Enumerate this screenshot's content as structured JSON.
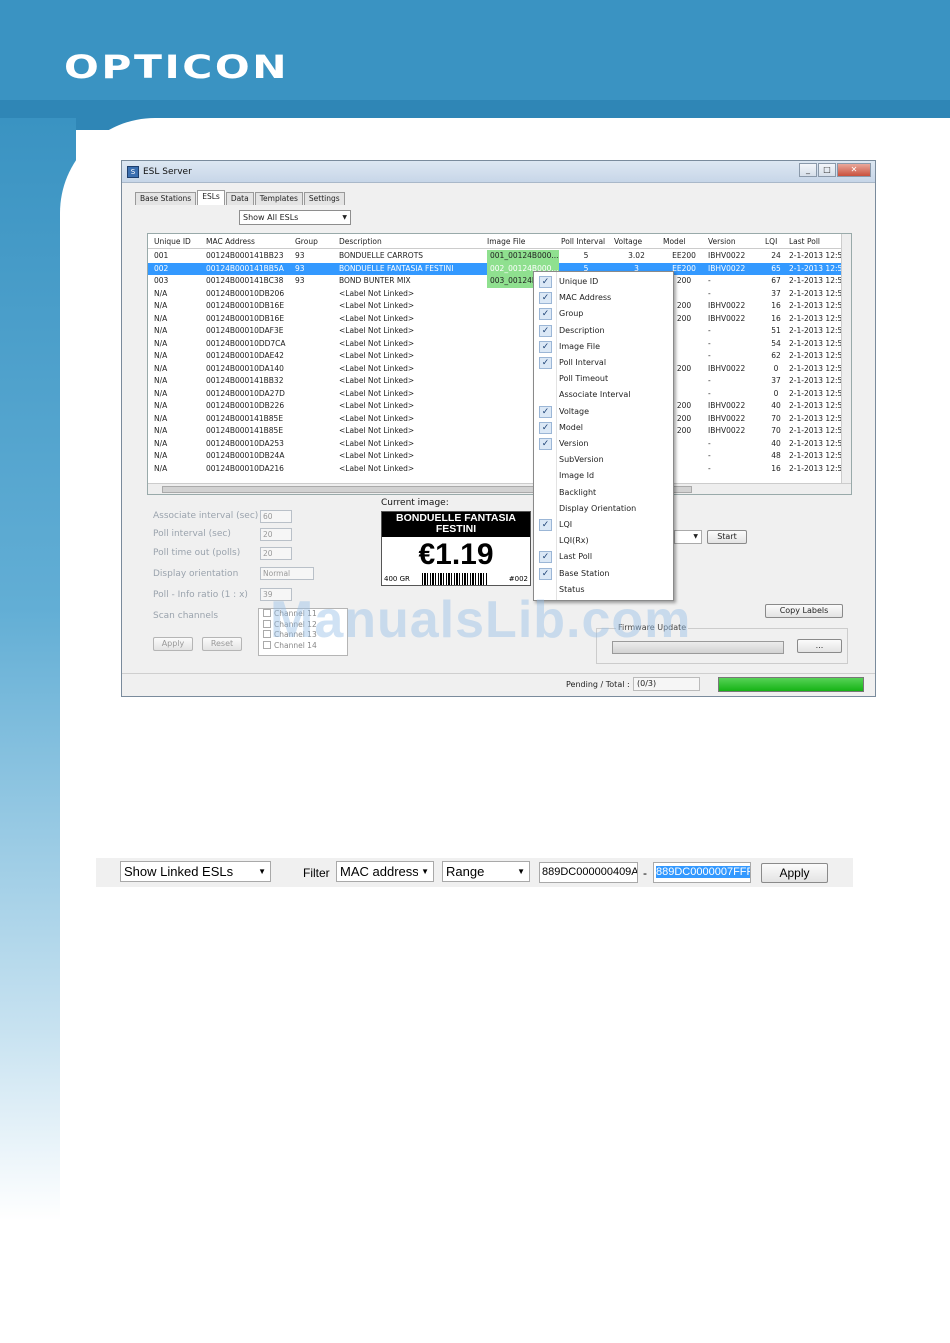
{
  "brand": {
    "logo": "OPTICON"
  },
  "window": {
    "title": "ESL Server",
    "icon_label": "S",
    "tabs": [
      "Base Stations",
      "ESLs",
      "Data",
      "Templates",
      "Settings"
    ],
    "active_tab": "ESLs",
    "view_select": "Show All ESLs",
    "columns": [
      "Unique ID",
      "MAC Address",
      "Group",
      "Description",
      "Image File",
      "Poll Interval",
      "Voltage",
      "Model",
      "Version",
      "LQI",
      "Last Poll"
    ],
    "rows": [
      {
        "id": "001",
        "mac": "00124B000141BB23",
        "group": "93",
        "desc": "BONDUELLE CARROTS",
        "img": "001_00124B000...",
        "poll": "5",
        "volt": "3.02",
        "model": "EE200",
        "ver": "IBHV0022",
        "lqi": "24",
        "last": "2-1-2013 12:5"
      },
      {
        "id": "002",
        "mac": "00124B000141BB5A",
        "group": "93",
        "desc": "BONDUELLE FANTASIA FESTINI",
        "img": "002_00124B000...",
        "poll": "5",
        "volt": "3",
        "model": "EE200",
        "ver": "IBHV0022",
        "lqi": "65",
        "last": "2-1-2013 12:5"
      },
      {
        "id": "003",
        "mac": "00124B000141BC38",
        "group": "93",
        "desc": "BOND BUNTER MIX",
        "img": "003_00124B",
        "poll": "",
        "volt": "",
        "model": "200",
        "ver": "-",
        "lqi": "67",
        "last": "2-1-2013 12:5"
      },
      {
        "id": "N/A",
        "mac": "00124B00010DB206",
        "group": "",
        "desc": "<Label Not Linked>",
        "img": "",
        "poll": "",
        "volt": "",
        "model": "",
        "ver": "-",
        "lqi": "37",
        "last": "2-1-2013 12:5"
      },
      {
        "id": "N/A",
        "mac": "00124B00010DB16E",
        "group": "",
        "desc": "<Label Not Linked>",
        "img": "",
        "poll": "",
        "volt": "",
        "model": "200",
        "ver": "IBHV0022",
        "lqi": "16",
        "last": "2-1-2013 12:5"
      },
      {
        "id": "N/A",
        "mac": "00124B00010DB16E",
        "group": "",
        "desc": "<Label Not Linked>",
        "img": "",
        "poll": "",
        "volt": "",
        "model": "200",
        "ver": "IBHV0022",
        "lqi": "16",
        "last": "2-1-2013 12:5"
      },
      {
        "id": "N/A",
        "mac": "00124B00010DAF3E",
        "group": "",
        "desc": "<Label Not Linked>",
        "img": "",
        "poll": "",
        "volt": "",
        "model": "",
        "ver": "-",
        "lqi": "51",
        "last": "2-1-2013 12:5"
      },
      {
        "id": "N/A",
        "mac": "00124B00010DD7CA",
        "group": "",
        "desc": "<Label Not Linked>",
        "img": "",
        "poll": "",
        "volt": "",
        "model": "",
        "ver": "-",
        "lqi": "54",
        "last": "2-1-2013 12:5"
      },
      {
        "id": "N/A",
        "mac": "00124B00010DAE42",
        "group": "",
        "desc": "<Label Not Linked>",
        "img": "",
        "poll": "",
        "volt": "",
        "model": "",
        "ver": "-",
        "lqi": "62",
        "last": "2-1-2013 12:5"
      },
      {
        "id": "N/A",
        "mac": "00124B00010DA140",
        "group": "",
        "desc": "<Label Not Linked>",
        "img": "",
        "poll": "",
        "volt": "",
        "model": "200",
        "ver": "IBHV0022",
        "lqi": "0",
        "last": "2-1-2013 12:5"
      },
      {
        "id": "N/A",
        "mac": "00124B000141BB32",
        "group": "",
        "desc": "<Label Not Linked>",
        "img": "",
        "poll": "",
        "volt": "",
        "model": "",
        "ver": "-",
        "lqi": "37",
        "last": "2-1-2013 12:5"
      },
      {
        "id": "N/A",
        "mac": "00124B00010DA27D",
        "group": "",
        "desc": "<Label Not Linked>",
        "img": "",
        "poll": "",
        "volt": "",
        "model": "",
        "ver": "-",
        "lqi": "0",
        "last": "2-1-2013 12:5"
      },
      {
        "id": "N/A",
        "mac": "00124B00010DB226",
        "group": "",
        "desc": "<Label Not Linked>",
        "img": "",
        "poll": "",
        "volt": "",
        "model": "200",
        "ver": "IBHV0022",
        "lqi": "40",
        "last": "2-1-2013 12:5"
      },
      {
        "id": "N/A",
        "mac": "00124B000141B85E",
        "group": "",
        "desc": "<Label Not Linked>",
        "img": "",
        "poll": "",
        "volt": "",
        "model": "200",
        "ver": "IBHV0022",
        "lqi": "70",
        "last": "2-1-2013 12:5"
      },
      {
        "id": "N/A",
        "mac": "00124B000141B85E",
        "group": "",
        "desc": "<Label Not Linked>",
        "img": "",
        "poll": "",
        "volt": "",
        "model": "200",
        "ver": "IBHV0022",
        "lqi": "70",
        "last": "2-1-2013 12:5"
      },
      {
        "id": "N/A",
        "mac": "00124B00010DA253",
        "group": "",
        "desc": "<Label Not Linked>",
        "img": "",
        "poll": "",
        "volt": "",
        "model": "",
        "ver": "-",
        "lqi": "40",
        "last": "2-1-2013 12:5"
      },
      {
        "id": "N/A",
        "mac": "00124B00010DB24A",
        "group": "",
        "desc": "<Label Not Linked>",
        "img": "",
        "poll": "",
        "volt": "",
        "model": "",
        "ver": "-",
        "lqi": "48",
        "last": "2-1-2013 12:5"
      },
      {
        "id": "N/A",
        "mac": "00124B00010DA216",
        "group": "",
        "desc": "<Label Not Linked>",
        "img": "",
        "poll": "",
        "volt": "",
        "model": "",
        "ver": "-",
        "lqi": "16",
        "last": "2-1-2013 12:5"
      }
    ],
    "selected_row": 1,
    "settings": {
      "assoc_label": "Associate interval (sec)",
      "assoc_value": "60",
      "poll_label": "Poll interval (sec)",
      "poll_value": "20",
      "timeout_label": "Poll time out (polls)",
      "timeout_value": "20",
      "orient_label": "Display orientation",
      "orient_value": "Normal",
      "ratio_label": "Poll - Info ratio (1 : x)",
      "ratio_value": "39",
      "scan_label": "Scan channels",
      "channels": [
        "Channel 11",
        "Channel 12",
        "Channel 13",
        "Channel 14"
      ],
      "apply": "Apply",
      "reset": "Reset"
    },
    "current_image": {
      "label": "Current image:",
      "line1": "BONDUELLE FANTASIA",
      "line2": "FESTINI",
      "price": "€1.19",
      "weight": "400 GR",
      "id": "#002"
    },
    "context_menu": [
      {
        "label": "Unique ID",
        "checked": true
      },
      {
        "label": "MAC Address",
        "checked": true
      },
      {
        "label": "Group",
        "checked": true
      },
      {
        "label": "Description",
        "checked": true
      },
      {
        "label": "Image File",
        "checked": true
      },
      {
        "label": "Poll Interval",
        "checked": true
      },
      {
        "label": "Poll Timeout",
        "checked": false
      },
      {
        "label": "Associate Interval",
        "checked": false
      },
      {
        "label": "Voltage",
        "checked": true
      },
      {
        "label": "Model",
        "checked": true
      },
      {
        "label": "Version",
        "checked": true
      },
      {
        "label": "SubVersion",
        "checked": false
      },
      {
        "label": "Image Id",
        "checked": false
      },
      {
        "label": "Backlight",
        "checked": false
      },
      {
        "label": "Display Orientation",
        "checked": false
      },
      {
        "label": "LQI",
        "checked": true
      },
      {
        "label": "LQI(Rx)",
        "checked": false
      },
      {
        "label": "Last Poll",
        "checked": true
      },
      {
        "label": "Base Station",
        "checked": true
      },
      {
        "label": "Status",
        "checked": false
      }
    ],
    "start_button": "Start",
    "copy_labels": "Copy Labels",
    "firmware_label": "Firmware Update",
    "browse_button": "...",
    "pending_label": "Pending / Total :",
    "pending_value": "(0/3)"
  },
  "watermark": "ManualsLib.com",
  "filter_bar": {
    "view_select": "Show Linked ESLs",
    "filter_label": "Filter",
    "field_select": "MAC address",
    "mode_select": "Range",
    "from_value": "889DC000000409A",
    "separator": "-",
    "to_value": "889DC0000007FFF",
    "apply": "Apply"
  }
}
